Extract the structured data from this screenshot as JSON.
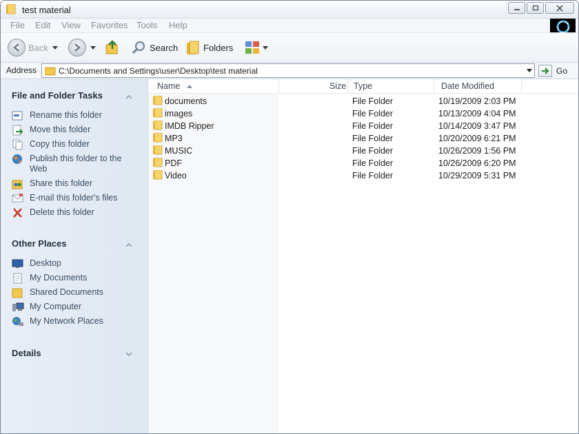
{
  "window": {
    "title": "test material"
  },
  "menu": {
    "items": [
      "File",
      "Edit",
      "View",
      "Favorites",
      "Tools",
      "Help"
    ]
  },
  "toolbar": {
    "back_label": "Back",
    "search_label": "Search",
    "folders_label": "Folders"
  },
  "address": {
    "label": "Address",
    "path": "C:\\Documents and Settings\\user\\Desktop\\test material",
    "go_label": "Go"
  },
  "taskpane": {
    "file_folder_tasks": {
      "title": "File and Folder Tasks",
      "items": [
        {
          "label": "Rename this folder",
          "icon": "rename-icon"
        },
        {
          "label": "Move this folder",
          "icon": "move-icon"
        },
        {
          "label": "Copy this folder",
          "icon": "copy-icon"
        },
        {
          "label": "Publish this folder to the Web",
          "icon": "globe-icon"
        },
        {
          "label": "Share this folder",
          "icon": "share-icon"
        },
        {
          "label": "E-mail this folder's files",
          "icon": "email-icon"
        },
        {
          "label": "Delete this folder",
          "icon": "delete-icon"
        }
      ]
    },
    "other_places": {
      "title": "Other Places",
      "items": [
        {
          "label": "Desktop",
          "icon": "desktop-icon"
        },
        {
          "label": "My Documents",
          "icon": "documents-icon"
        },
        {
          "label": "Shared Documents",
          "icon": "folder-icon"
        },
        {
          "label": "My Computer",
          "icon": "computer-icon"
        },
        {
          "label": "My Network Places",
          "icon": "network-icon"
        }
      ]
    },
    "details": {
      "title": "Details"
    }
  },
  "filelist": {
    "columns": {
      "name": "Name",
      "size": "Size",
      "type": "Type",
      "date": "Date Modified"
    },
    "rows": [
      {
        "name": "documents",
        "type": "File Folder",
        "date": "10/19/2009 2:03 PM"
      },
      {
        "name": "images",
        "type": "File Folder",
        "date": "10/13/2009 4:04 PM"
      },
      {
        "name": "IMDB Ripper",
        "type": "File Folder",
        "date": "10/14/2009 3:47 PM"
      },
      {
        "name": "MP3",
        "type": "File Folder",
        "date": "10/20/2009 6:21 PM"
      },
      {
        "name": "MUSIC",
        "type": "File Folder",
        "date": "10/26/2009 1:56 PM"
      },
      {
        "name": "PDF",
        "type": "File Folder",
        "date": "10/26/2009 6:20 PM"
      },
      {
        "name": "Video",
        "type": "File Folder",
        "date": "10/29/2009 5:31 PM"
      }
    ]
  },
  "colors": {
    "taskpane_bg": "#e3eaf4",
    "link": "#3b4c60",
    "folder": "#f2c94c"
  }
}
